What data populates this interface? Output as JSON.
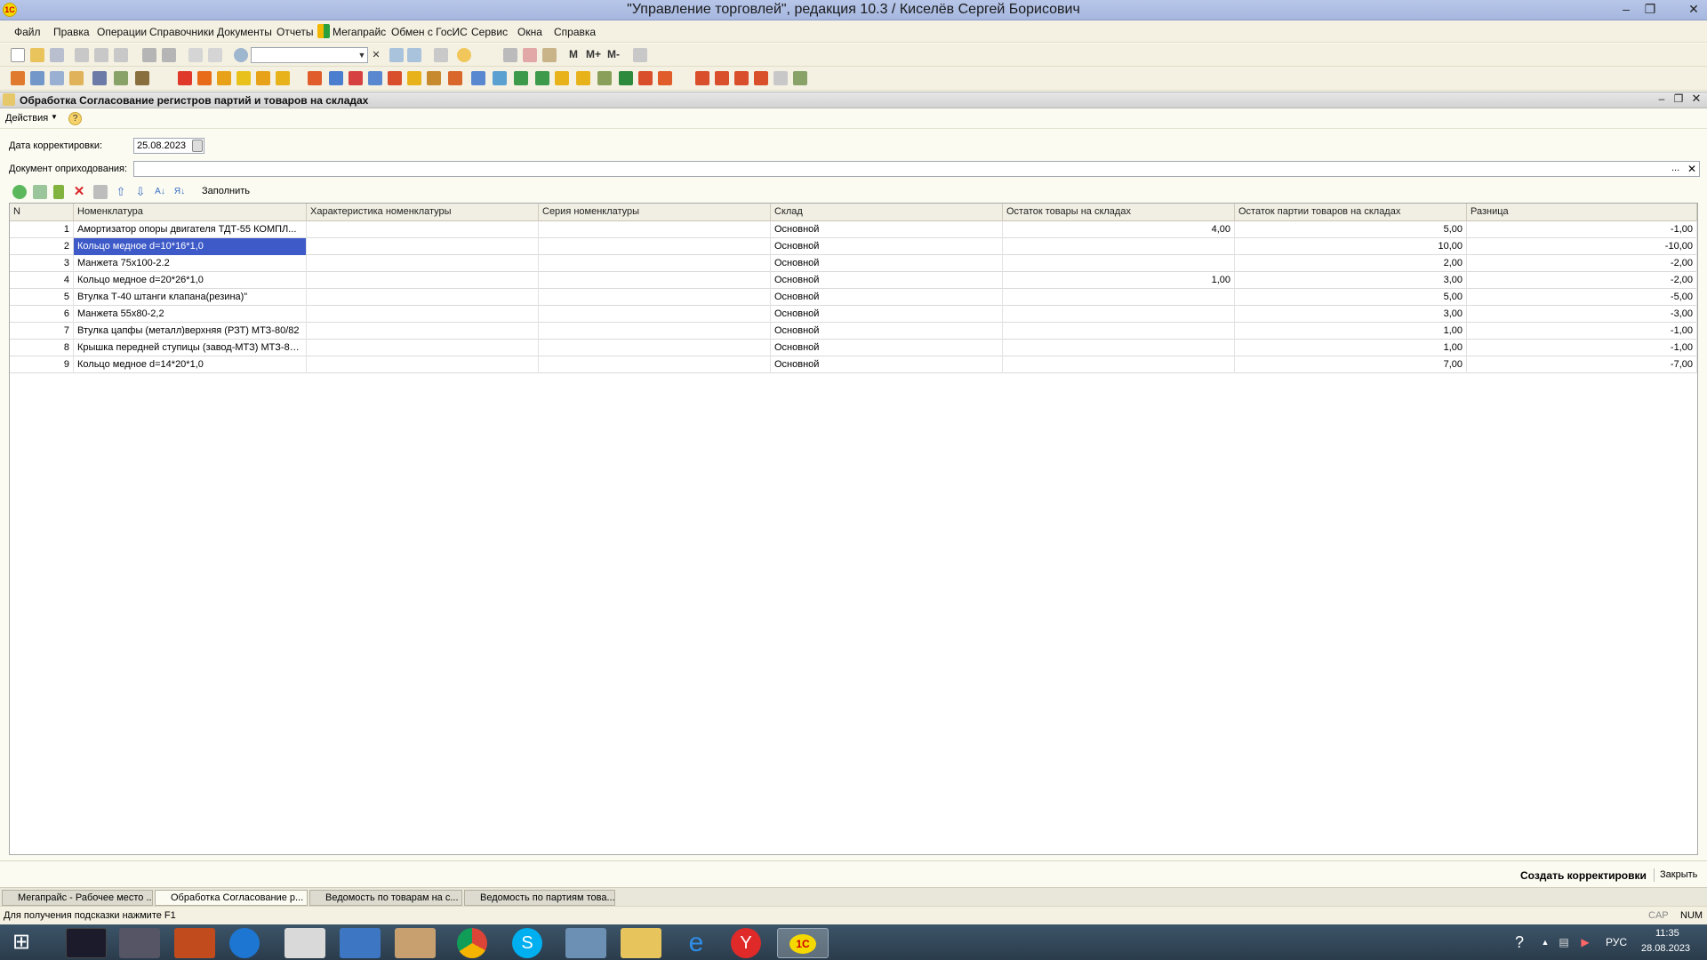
{
  "window": {
    "title": "\"Управление торговлей\", редакция 10.3 / Киселёв Сергей Борисович",
    "logo_icon": "1c-logo-icon",
    "controls": [
      "minimize-icon",
      "restore-icon",
      "close-icon"
    ]
  },
  "menu": [
    "Файл",
    "Правка",
    "Операции",
    "Справочники",
    "Документы",
    "Отчеты",
    "Мегапрайс",
    "Обмен с ГосИС",
    "Сервис",
    "Окна",
    "Справка"
  ],
  "toolbar1": {
    "m_label": "M",
    "mplus_label": "M+",
    "mminus_label": "M-"
  },
  "doc_window": {
    "title": "Обработка  Согласование регистров партий и товаров на складах",
    "actions_label": "Действия",
    "date_label": "Дата корректировки:",
    "date_value": "25.08.2023",
    "doc_label": "Документ оприходования:",
    "doc_value": "",
    "doc_select": "...",
    "fill_label": "Заполнить"
  },
  "table": {
    "columns": [
      "N",
      "Номенклатура",
      "Характеристика номенклатуры",
      "Серия номенклатуры",
      "Склад",
      "Остаток товары на складах",
      "Остаток партии товаров на складах",
      "Разница"
    ],
    "rows": [
      {
        "n": "1",
        "item": "Амортизатор опоры двигателя ТДТ-55 КОМПЛ...",
        "char": "",
        "series": "",
        "warehouse": "Основной",
        "stock": "4,00",
        "batch": "5,00",
        "diff": "-1,00"
      },
      {
        "n": "2",
        "item": "Кольцо медное d=10*16*1,0",
        "char": "",
        "series": "",
        "warehouse": "Основной",
        "stock": "",
        "batch": "10,00",
        "diff": "-10,00"
      },
      {
        "n": "3",
        "item": "Манжета 75х100-2.2",
        "char": "",
        "series": "",
        "warehouse": "Основной",
        "stock": "",
        "batch": "2,00",
        "diff": "-2,00"
      },
      {
        "n": "4",
        "item": "Кольцо медное d=20*26*1,0",
        "char": "",
        "series": "",
        "warehouse": "Основной",
        "stock": "1,00",
        "batch": "3,00",
        "diff": "-2,00"
      },
      {
        "n": "5",
        "item": "Втулка Т-40 штанги клапана(резина)\"",
        "char": "",
        "series": "",
        "warehouse": "Основной",
        "stock": "",
        "batch": "5,00",
        "diff": "-5,00"
      },
      {
        "n": "6",
        "item": "Манжета 55х80-2,2",
        "char": "",
        "series": "",
        "warehouse": "Основной",
        "stock": "",
        "batch": "3,00",
        "diff": "-3,00"
      },
      {
        "n": "7",
        "item": "Втулка цапфы (металл)верхняя (РЗТ)  МТЗ-80/82",
        "char": "",
        "series": "",
        "warehouse": "Основной",
        "stock": "",
        "batch": "1,00",
        "diff": "-1,00"
      },
      {
        "n": "8",
        "item": "Крышка передней ступицы (завод-МТЗ)  МТЗ-80...",
        "char": "",
        "series": "",
        "warehouse": "Основной",
        "stock": "",
        "batch": "1,00",
        "diff": "-1,00"
      },
      {
        "n": "9",
        "item": "Кольцо медное d=14*20*1,0",
        "char": "",
        "series": "",
        "warehouse": "Основной",
        "stock": "",
        "batch": "7,00",
        "diff": "-7,00"
      }
    ]
  },
  "bottom": {
    "create_label": "Создать корректировки",
    "close_label": "Закрыть"
  },
  "window_tabs": [
    "Мегапрайс - Рабочее место ...",
    "Обработка  Согласование р...",
    "Ведомость по товарам на с...",
    "Ведомость по партиям това..."
  ],
  "status": {
    "hint": "Для получения подсказки нажмите F1",
    "cap": "CAP",
    "num": "NUM"
  },
  "taskbar": {
    "lang": "РУС",
    "time": "11:35",
    "date": "28.08.2023"
  }
}
